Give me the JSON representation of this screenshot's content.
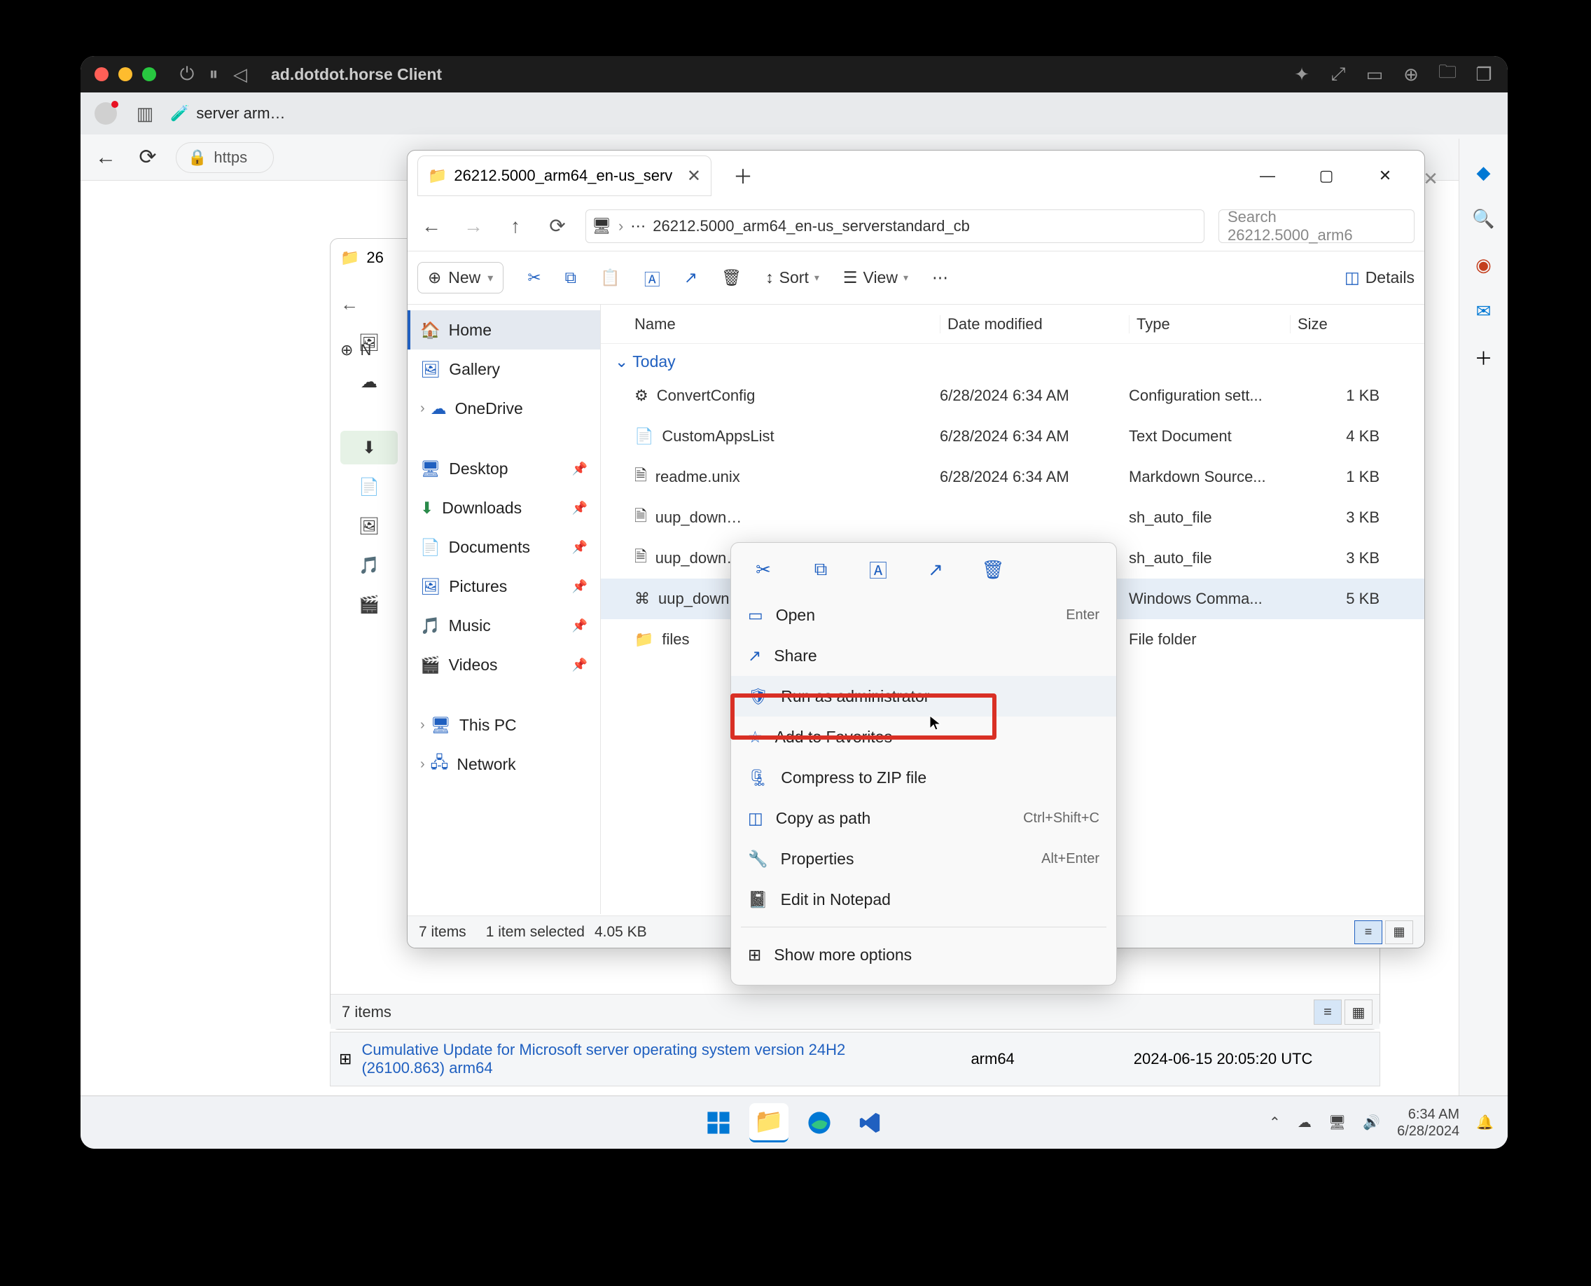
{
  "titlebar": {
    "title": "ad.dotdot.horse Client"
  },
  "browser": {
    "tab_label": "server arm…",
    "address_prefix": "https"
  },
  "bg_explorer": {
    "status": "7 items"
  },
  "bottom_row": {
    "link_text": "Cumulative Update for Microsoft server operating system version 24H2 (26100.863) arm64",
    "arch": "arm64",
    "date": "2024-06-15 20:05:20 UTC"
  },
  "fg": {
    "tab_label": "26212.5000_arm64_en-us_serv",
    "breadcrumb": "26212.5000_arm64_en-us_serverstandard_cb",
    "search_placeholder": "Search 26212.5000_arm6",
    "toolbar": {
      "new": "New",
      "sort": "Sort",
      "view": "View",
      "details": "Details"
    },
    "cols": {
      "name": "Name",
      "date": "Date modified",
      "type": "Type",
      "size": "Size"
    },
    "group": "Today",
    "sidebar": {
      "home": "Home",
      "gallery": "Gallery",
      "onedrive": "OneDrive",
      "desktop": "Desktop",
      "downloads": "Downloads",
      "documents": "Documents",
      "pictures": "Pictures",
      "music": "Music",
      "videos": "Videos",
      "thispc": "This PC",
      "network": "Network"
    },
    "rows": [
      {
        "name": "ConvertConfig",
        "date": "6/28/2024 6:34 AM",
        "type": "Configuration sett...",
        "size": "1 KB"
      },
      {
        "name": "CustomAppsList",
        "date": "6/28/2024 6:34 AM",
        "type": "Text Document",
        "size": "4 KB"
      },
      {
        "name": "readme.unix",
        "date": "6/28/2024 6:34 AM",
        "type": "Markdown Source...",
        "size": "1 KB"
      },
      {
        "name": "uup_down…",
        "date": "",
        "type": "sh_auto_file",
        "size": "3 KB"
      },
      {
        "name": "uup_down…",
        "date": "",
        "type": "sh_auto_file",
        "size": "3 KB"
      },
      {
        "name": "uup_down…",
        "date": "",
        "type": "Windows Comma...",
        "size": "5 KB"
      },
      {
        "name": "files",
        "date": "",
        "type": "File folder",
        "size": ""
      }
    ],
    "status": {
      "items": "7 items",
      "selected": "1 item selected",
      "size": "4.05 KB"
    }
  },
  "ctx": {
    "open": "Open",
    "open_sc": "Enter",
    "share": "Share",
    "runas": "Run as administrator",
    "fav": "Add to Favorites",
    "zip": "Compress to ZIP file",
    "copypath": "Copy as path",
    "copypath_sc": "Ctrl+Shift+C",
    "props": "Properties",
    "props_sc": "Alt+Enter",
    "notepad": "Edit in Notepad",
    "more": "Show more options"
  },
  "taskbar": {
    "time": "6:34 AM",
    "date": "6/28/2024"
  }
}
